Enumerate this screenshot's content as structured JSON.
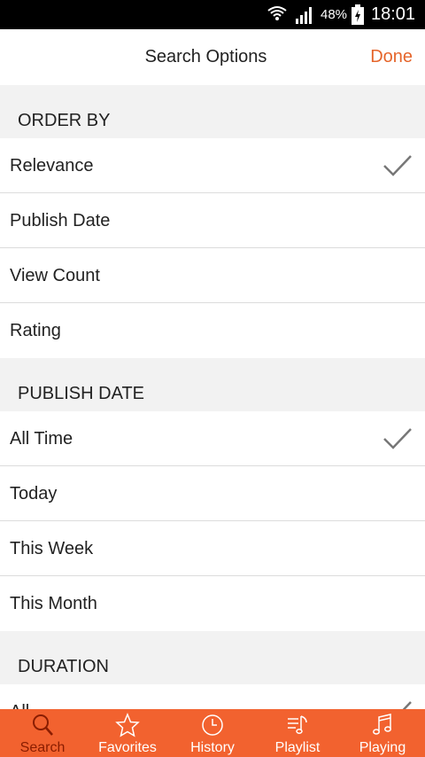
{
  "status_bar": {
    "battery": "48%",
    "time": "18:01"
  },
  "nav": {
    "title": "Search Options",
    "done": "Done"
  },
  "sections": [
    {
      "header": "ORDER BY",
      "items": [
        {
          "label": "Relevance",
          "checked": true
        },
        {
          "label": "Publish Date",
          "checked": false
        },
        {
          "label": "View Count",
          "checked": false
        },
        {
          "label": "Rating",
          "checked": false
        }
      ]
    },
    {
      "header": "PUBLISH DATE",
      "items": [
        {
          "label": "All Time",
          "checked": true
        },
        {
          "label": "Today",
          "checked": false
        },
        {
          "label": "This Week",
          "checked": false
        },
        {
          "label": "This Month",
          "checked": false
        }
      ]
    },
    {
      "header": "DURATION",
      "items": [
        {
          "label": "All",
          "checked": true
        }
      ]
    }
  ],
  "tabs": [
    {
      "label": "Search",
      "icon": "search-icon",
      "active": true
    },
    {
      "label": "Favorites",
      "icon": "star-icon",
      "active": false
    },
    {
      "label": "History",
      "icon": "clock-icon",
      "active": false
    },
    {
      "label": "Playlist",
      "icon": "playlist-icon",
      "active": false
    },
    {
      "label": "Playing",
      "icon": "music-note-icon",
      "active": false
    }
  ],
  "colors": {
    "accent": "#e5652b",
    "tab_bar": "#f2622f",
    "active_tab": "#8a1d00"
  }
}
